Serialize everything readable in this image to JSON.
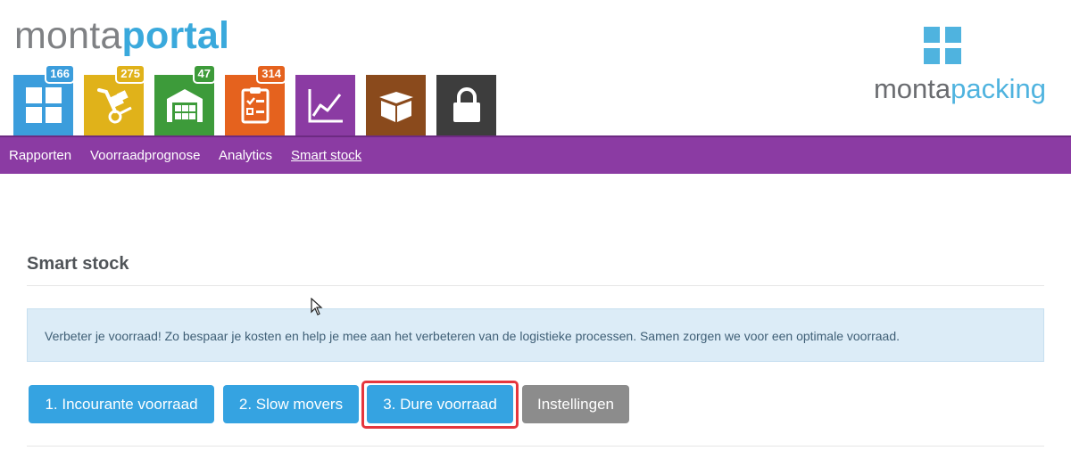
{
  "header": {
    "brand": {
      "part1": "monta",
      "part2": "portal"
    },
    "tiles": [
      {
        "icon": "dashboard-grid-icon",
        "color": "#3b9ddc",
        "badge": "166",
        "badge_color": "#3b9ddc"
      },
      {
        "icon": "hand-truck-icon",
        "color": "#e0b21a",
        "badge": "275",
        "badge_color": "#e0b21a"
      },
      {
        "icon": "warehouse-icon",
        "color": "#3d9b3a",
        "badge": "47",
        "badge_color": "#3d9b3a"
      },
      {
        "icon": "clipboard-checklist-icon",
        "color": "#e5621e",
        "badge": "314",
        "badge_color": "#e5621e"
      },
      {
        "icon": "line-chart-icon",
        "color": "#8b3ba3",
        "badge": "",
        "badge_color": ""
      },
      {
        "icon": "open-box-icon",
        "color": "#8a4a1c",
        "badge": "",
        "badge_color": ""
      },
      {
        "icon": "padlock-icon",
        "color": "#3d3d3d",
        "badge": "",
        "badge_color": ""
      }
    ],
    "logo": {
      "part1": "monta",
      "part2": "packing"
    }
  },
  "nav": {
    "items": [
      {
        "label": "Rapporten"
      },
      {
        "label": "Voorraadprognose"
      },
      {
        "label": "Analytics"
      },
      {
        "label": "Smart stock",
        "active": true
      }
    ]
  },
  "main": {
    "title": "Smart stock",
    "info": "Verbeter je voorraad! Zo bespaar je kosten en help je mee aan het verbeteren van de logistieke processen. Samen zorgen we voor een optimale voorraad.",
    "buttons": [
      {
        "label": "1. Incourante voorraad"
      },
      {
        "label": "2. Slow movers"
      },
      {
        "label": "3. Dure voorraad",
        "highlighted": true
      },
      {
        "label": "Instellingen"
      }
    ]
  },
  "colors": {
    "nav_purple": "#8b3ba3",
    "button_blue": "#35a3e1",
    "button_gray": "#8c8c8c",
    "highlight_red": "#e5363d",
    "brand_blue": "#3aa9dc"
  }
}
